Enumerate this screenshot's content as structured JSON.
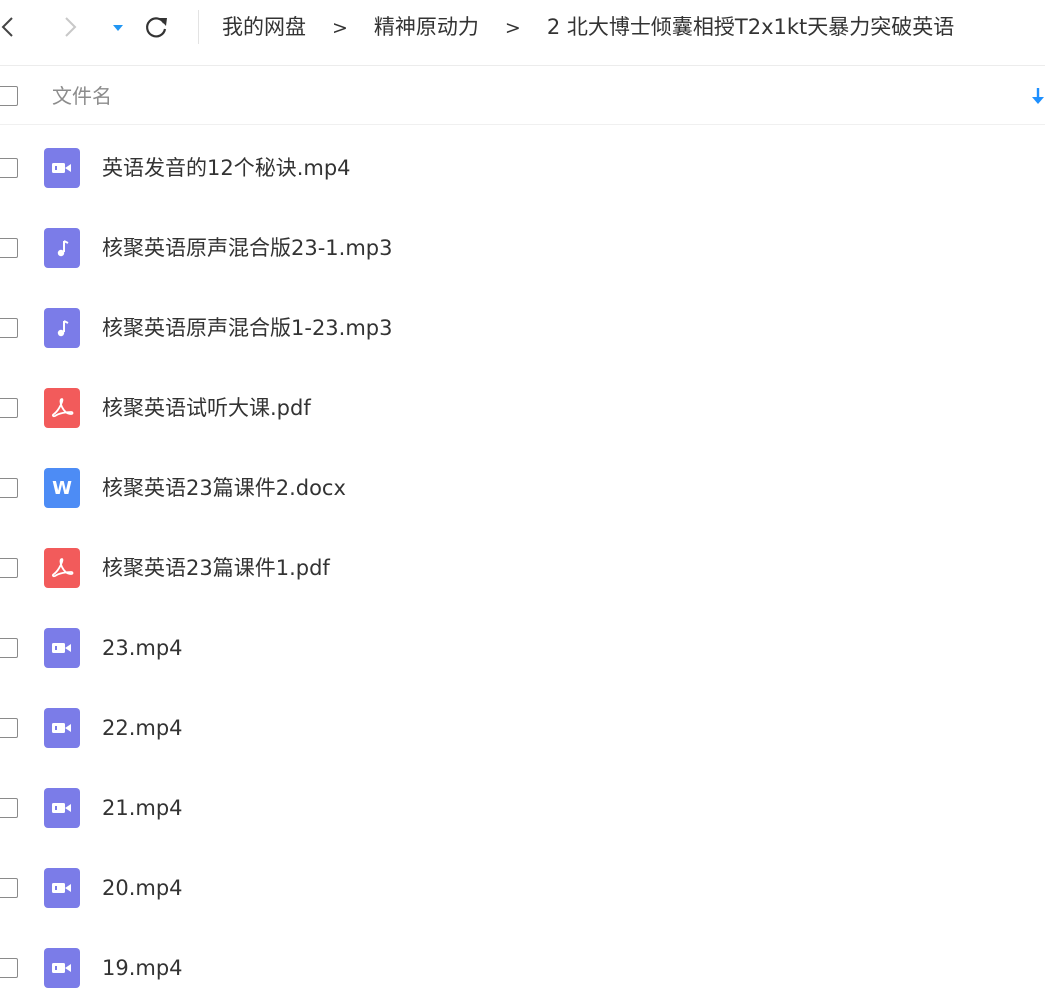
{
  "breadcrumb": [
    "我的网盘",
    "精神原动力",
    "2 北大博士倾囊相授T2x1kt天暴力突破英语"
  ],
  "breadcrumb_separator": ">",
  "header": {
    "filename_label": "文件名"
  },
  "files": [
    {
      "name": "英语发音的12个秘诀.mp4",
      "type": "video"
    },
    {
      "name": "核聚英语原声混合版23-1.mp3",
      "type": "audio"
    },
    {
      "name": "核聚英语原声混合版1-23.mp3",
      "type": "audio"
    },
    {
      "name": "核聚英语试听大课.pdf",
      "type": "pdf"
    },
    {
      "name": "核聚英语23篇课件2.docx",
      "type": "doc"
    },
    {
      "name": "核聚英语23篇课件1.pdf",
      "type": "pdf"
    },
    {
      "name": "23.mp4",
      "type": "video"
    },
    {
      "name": "22.mp4",
      "type": "video"
    },
    {
      "name": "21.mp4",
      "type": "video"
    },
    {
      "name": "20.mp4",
      "type": "video"
    },
    {
      "name": "19.mp4",
      "type": "video"
    }
  ],
  "icons": {
    "video": "video-file-icon",
    "audio": "audio-file-icon",
    "pdf": "pdf-file-icon",
    "doc": "word-file-icon"
  },
  "colors": {
    "video": "#7b7ce8",
    "audio": "#7b7ce8",
    "pdf": "#f25b5b",
    "doc": "#4d8cf5",
    "accent": "#1e90ff"
  }
}
